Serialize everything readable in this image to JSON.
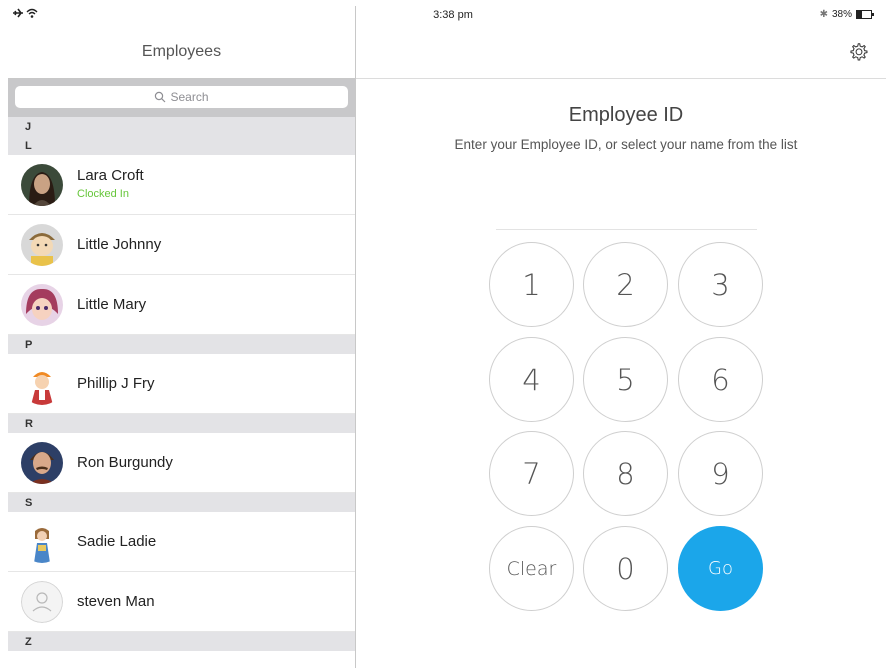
{
  "status_bar": {
    "time": "3:38 pm",
    "battery": "38%",
    "battery_level": 0.38
  },
  "left_panel": {
    "title": "Employees",
    "search": {
      "placeholder": "Search"
    },
    "sections": [
      {
        "letter": "J",
        "employees": []
      },
      {
        "letter": "L",
        "employees": [
          {
            "name": "Lara Croft",
            "status": "Clocked In",
            "avatar": "photo"
          },
          {
            "name": "Little Johnny",
            "status": "",
            "avatar": "photo"
          },
          {
            "name": "Little Mary",
            "status": "",
            "avatar": "photo"
          }
        ]
      },
      {
        "letter": "P",
        "employees": [
          {
            "name": "Phillip J Fry",
            "status": "",
            "avatar": "photo"
          }
        ]
      },
      {
        "letter": "R",
        "employees": [
          {
            "name": "Ron Burgundy",
            "status": "",
            "avatar": "photo"
          }
        ]
      },
      {
        "letter": "S",
        "employees": [
          {
            "name": "Sadie Ladie",
            "status": "",
            "avatar": "photo"
          },
          {
            "name": "steven Man",
            "status": "",
            "avatar": "placeholder-person-icon"
          }
        ]
      },
      {
        "letter": "Z",
        "employees": []
      }
    ]
  },
  "right_panel": {
    "title": "Employee ID",
    "subtitle": "Enter your Employee ID, or select your name from the list",
    "id_value": "",
    "keypad": [
      "1",
      "2",
      "3",
      "4",
      "5",
      "6",
      "7",
      "8",
      "9",
      "Clear",
      "0",
      "Go"
    ],
    "icons": {
      "settings": "gear-icon"
    },
    "colors": {
      "go_button": "#1ba6ea",
      "clocked_in": "#66c63a"
    }
  }
}
